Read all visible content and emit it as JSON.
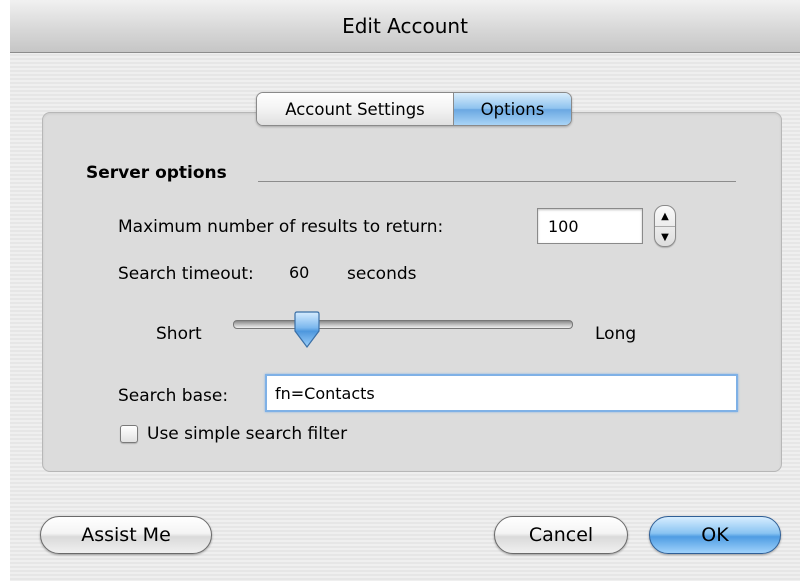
{
  "window": {
    "title": "Edit Account"
  },
  "tabs": [
    {
      "label": "Account Settings",
      "selected": false
    },
    {
      "label": "Options",
      "selected": true
    }
  ],
  "server_options": {
    "section_title": "Server options",
    "max_results_label": "Maximum number of results to return:",
    "max_results_value": "100",
    "timeout_label": "Search timeout:",
    "timeout_value": "60",
    "timeout_unit": "seconds",
    "slider_min_label": "Short",
    "slider_max_label": "Long",
    "slider_position": 0.22,
    "search_base_label": "Search base:",
    "search_base_value": "fn=Contacts",
    "simple_filter_label": "Use simple search filter",
    "simple_filter_checked": false
  },
  "buttons": {
    "assist": "Assist Me",
    "cancel": "Cancel",
    "ok": "OK"
  },
  "colors": {
    "accent": "#6aa8e2",
    "focus_ring": "#7fb1e6"
  }
}
